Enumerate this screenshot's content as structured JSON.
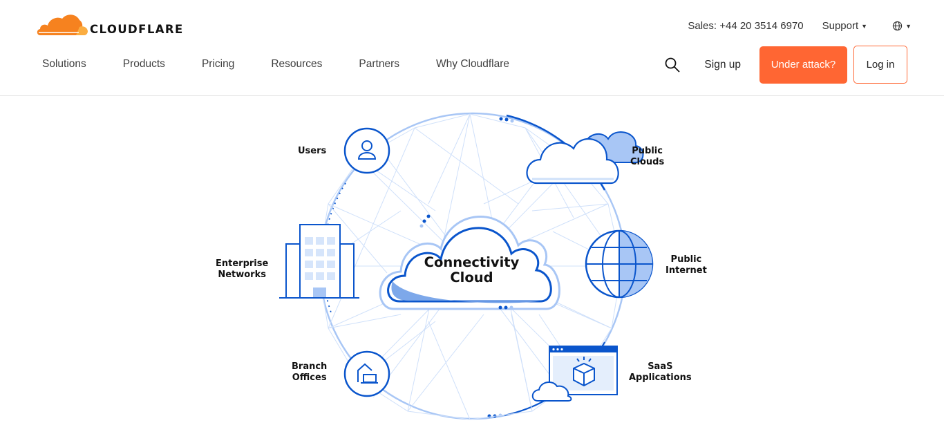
{
  "brand": {
    "name": "CLOUDFLARE",
    "accent": "#ff6633",
    "logo_orange": "#f6821f",
    "logo_light": "#fbad41"
  },
  "utility": {
    "sales": "Sales: +44 20 3514 6970",
    "support": "Support",
    "language_icon": "globe-icon"
  },
  "nav": {
    "items": [
      "Solutions",
      "Products",
      "Pricing",
      "Resources",
      "Partners",
      "Why Cloudflare"
    ]
  },
  "actions": {
    "search_icon": "search-icon",
    "sign_up": "Sign up",
    "under_attack": "Under attack?",
    "log_in": "Log in"
  },
  "diagram": {
    "center_line1": "Connectivity",
    "center_line2": "Cloud",
    "nodes": {
      "users": "Users",
      "public_clouds_1": "Public",
      "public_clouds_2": "Clouds",
      "enterprise_1": "Enterprise",
      "enterprise_2": "Networks",
      "public_internet_1": "Public",
      "public_internet_2": "Internet",
      "branch_1": "Branch",
      "branch_2": "Offices",
      "saas_1": "SaaS",
      "saas_2": "Applications"
    },
    "colors": {
      "primary": "#0a55cc",
      "light": "#a8c6f5",
      "mesh": "#cfe0fa"
    }
  }
}
